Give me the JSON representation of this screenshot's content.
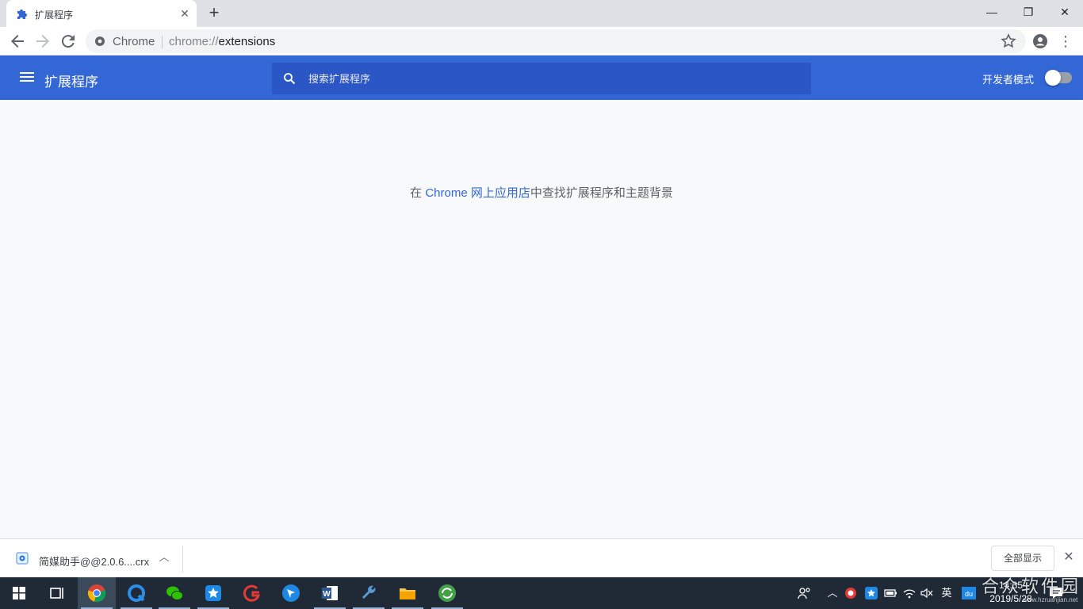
{
  "browser": {
    "tab": {
      "title": "扩展程序",
      "icon": "puzzle-icon"
    },
    "new_tab_label": "+",
    "window_controls": {
      "minimize": "—",
      "restore": "❐",
      "close": "✕"
    },
    "omnibox": {
      "site_label": "Chrome",
      "url_scheme": "chrome://",
      "url_path": "extensions"
    }
  },
  "extensions_page": {
    "title": "扩展程序",
    "search_placeholder": "搜索扩展程序",
    "developer_mode_label": "开发者模式",
    "developer_mode_on": false,
    "empty_message": {
      "prefix": "在 ",
      "link": "Chrome 网上应用店",
      "suffix": "中查找扩展程序和主题背景"
    },
    "accent_color": "#3367d6"
  },
  "download_shelf": {
    "file_name": "简媒助手@@2.0.6....crx",
    "show_all_label": "全部显示"
  },
  "taskbar": {
    "apps": [
      {
        "name": "task-view-icon",
        "active": false
      },
      {
        "name": "chrome-icon",
        "active": true
      },
      {
        "name": "browser-q-icon",
        "active": false
      },
      {
        "name": "wechat-icon",
        "active": false
      },
      {
        "name": "app-star-icon",
        "active": false
      },
      {
        "name": "app-red-icon",
        "active": false
      },
      {
        "name": "app-bird-icon",
        "active": false
      },
      {
        "name": "word-icon",
        "active": false
      },
      {
        "name": "wrench-icon",
        "active": false
      },
      {
        "name": "file-explorer-icon",
        "active": false
      },
      {
        "name": "app-green-icon",
        "active": false
      }
    ],
    "tray": {
      "ime": "英",
      "time": "14:35",
      "date": "2019/5/28"
    },
    "watermark": "合众软件园",
    "watermark_small": "www.hzruanjian.net"
  }
}
